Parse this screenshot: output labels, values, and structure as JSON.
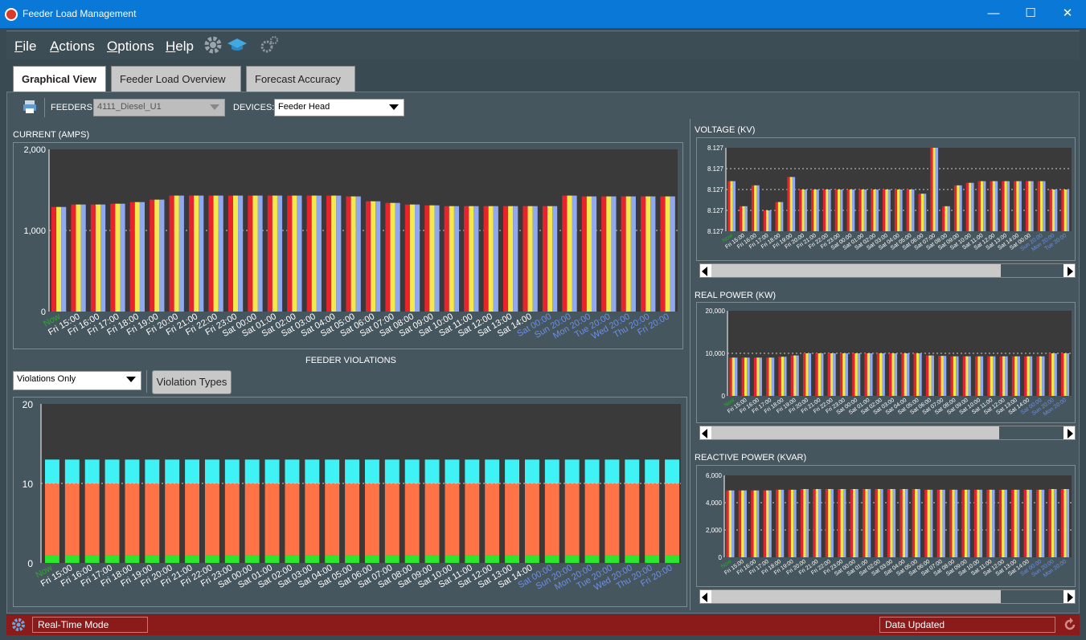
{
  "window": {
    "title": "Feeder Load Management",
    "minimize": "—",
    "maximize": "☐",
    "close": "✕"
  },
  "menu": {
    "file": "ile",
    "file_u": "F",
    "actions": "ctions",
    "actions_u": "A",
    "options": "ptions",
    "options_u": "O",
    "help": "elp",
    "help_u": "H"
  },
  "tabs": [
    "Graphical View",
    "Feeder Load Overview",
    "Forecast Accuracy"
  ],
  "toolbar": {
    "feeders_label": "FEEDERS:",
    "feeders_value": "4111_Diesel_U1",
    "devices_label": "DEVICES:",
    "devices_value": "Feeder Head"
  },
  "sections": {
    "current": "CURRENT (AMPS)",
    "violations": "FEEDER VIOLATIONS",
    "voltage": "VOLTAGE (KV)",
    "real_power": "REAL POWER (KW)",
    "reactive_power": "REACTIVE POWER (KVAR)"
  },
  "violations_filter": "Violations Only",
  "violation_types_button": "Violation Types",
  "status": {
    "mode": "Real-Time Mode",
    "message": "Data Updated"
  },
  "colors": {
    "red": "#e8232e",
    "yellow": "#f5e84a",
    "blue": "#8fa8f0",
    "cyan": "#3ff2f5",
    "orange": "#ff7346",
    "green": "#2ee62e",
    "plot_bg": "#3a3a3a"
  },
  "chart_data": [
    {
      "id": "current",
      "type": "bar",
      "categories": [
        "Now",
        "Fri 15:00",
        "Fri 16:00",
        "Fri 17:00",
        "Fri 18:00",
        "Fri 19:00",
        "Fri 20:00",
        "Fri 21:00",
        "Fri 22:00",
        "Fri 23:00",
        "Sat 00:00",
        "Sat 01:00",
        "Sat 02:00",
        "Sat 03:00",
        "Sat 04:00",
        "Sat 05:00",
        "Sat 06:00",
        "Sat 07:00",
        "Sat 08:00",
        "Sat 09:00",
        "Sat 10:00",
        "Sat 11:00",
        "Sat 12:00",
        "Sat 13:00",
        "Sat 14:00",
        "Sat 00:00",
        "Sun 20:00",
        "Mon 20:00",
        "Tue 20:00",
        "Wed 20:00",
        "Thu 20:00",
        "Fri 20:00"
      ],
      "values": [
        1290,
        1320,
        1320,
        1330,
        1350,
        1380,
        1430,
        1430,
        1430,
        1430,
        1430,
        1430,
        1430,
        1430,
        1430,
        1420,
        1360,
        1340,
        1320,
        1310,
        1300,
        1300,
        1300,
        1300,
        1300,
        1300,
        1430,
        1420,
        1420,
        1420,
        1420,
        1420
      ],
      "ylim": [
        0,
        2000
      ],
      "yticks": [
        "0",
        "1,000",
        "2,000"
      ],
      "reference_line": 1000
    },
    {
      "id": "violations",
      "type": "bar",
      "stacked": true,
      "categories": [
        "Now",
        "Fri 15:00",
        "Fri 16:00",
        "Fri 17:00",
        "Fri 18:00",
        "Fri 19:00",
        "Fri 20:00",
        "Fri 21:00",
        "Fri 22:00",
        "Fri 23:00",
        "Sat 00:00",
        "Sat 01:00",
        "Sat 02:00",
        "Sat 03:00",
        "Sat 04:00",
        "Sat 05:00",
        "Sat 06:00",
        "Sat 07:00",
        "Sat 08:00",
        "Sat 09:00",
        "Sat 10:00",
        "Sat 11:00",
        "Sat 12:00",
        "Sat 13:00",
        "Sat 14:00",
        "Sat 00:00",
        "Sun 20:00",
        "Mon 20:00",
        "Tue 20:00",
        "Wed 20:00",
        "Thu 20:00",
        "Fri 20:00"
      ],
      "series": [
        {
          "values": [
            1,
            1,
            1,
            1,
            1,
            1,
            1,
            1,
            1,
            1,
            1,
            1,
            1,
            1,
            1,
            1,
            1,
            1,
            1,
            1,
            1,
            1,
            1,
            1,
            1,
            1,
            1,
            1,
            1,
            1,
            1,
            1
          ]
        },
        {
          "values": [
            9,
            9,
            9,
            9,
            9,
            9,
            9,
            9,
            9,
            9,
            9,
            9,
            9,
            9,
            9,
            9,
            9,
            9,
            9,
            9,
            9,
            9,
            9,
            9,
            9,
            9,
            9,
            9,
            9,
            9,
            9,
            9
          ]
        },
        {
          "values": [
            3,
            3,
            3,
            3,
            3,
            3,
            3,
            3,
            3,
            3,
            3,
            3,
            3,
            3,
            3,
            3,
            3,
            3,
            3,
            3,
            3,
            3,
            3,
            3,
            3,
            3,
            3,
            3,
            3,
            3,
            3,
            3
          ]
        }
      ],
      "ylim": [
        0,
        20
      ],
      "yticks": [
        "0",
        "10",
        "20"
      ]
    },
    {
      "id": "voltage",
      "type": "bar",
      "values": [
        0.6,
        0.3,
        0.55,
        0.25,
        0.35,
        0.65,
        0.5,
        0.5,
        0.5,
        0.5,
        0.5,
        0.5,
        0.5,
        0.5,
        0.5,
        0.5,
        0.45,
        1.0,
        0.3,
        0.55,
        0.58,
        0.6,
        0.6,
        0.6,
        0.6,
        0.6,
        0.6,
        0.5,
        0.5
      ],
      "yticks": [
        "8.127",
        "8.127",
        "8.127",
        "8.127",
        "8.127"
      ]
    },
    {
      "id": "real_power",
      "type": "bar",
      "values": [
        9000,
        9000,
        9000,
        9000,
        9200,
        9500,
        10000,
        10000,
        10000,
        10000,
        10000,
        10000,
        10000,
        10000,
        10000,
        10000,
        9500,
        9400,
        9300,
        9300,
        9300,
        9300,
        9300,
        9300,
        9300,
        9300,
        10000,
        10000
      ],
      "ylim": [
        0,
        20000
      ],
      "yticks": [
        "0",
        "10,000",
        "20,000"
      ]
    },
    {
      "id": "reactive_power",
      "type": "bar",
      "values": [
        4900,
        4900,
        4900,
        4900,
        4950,
        4950,
        5000,
        5000,
        5000,
        5000,
        5000,
        5000,
        5000,
        5000,
        5000,
        5000,
        4950,
        4950,
        4950,
        4950,
        4950,
        4950,
        4950,
        4950,
        4950,
        4950,
        5000,
        5000
      ],
      "ylim": [
        0,
        6000
      ],
      "yticks": [
        "0",
        "2,000",
        "4,000",
        "6,000"
      ]
    }
  ]
}
